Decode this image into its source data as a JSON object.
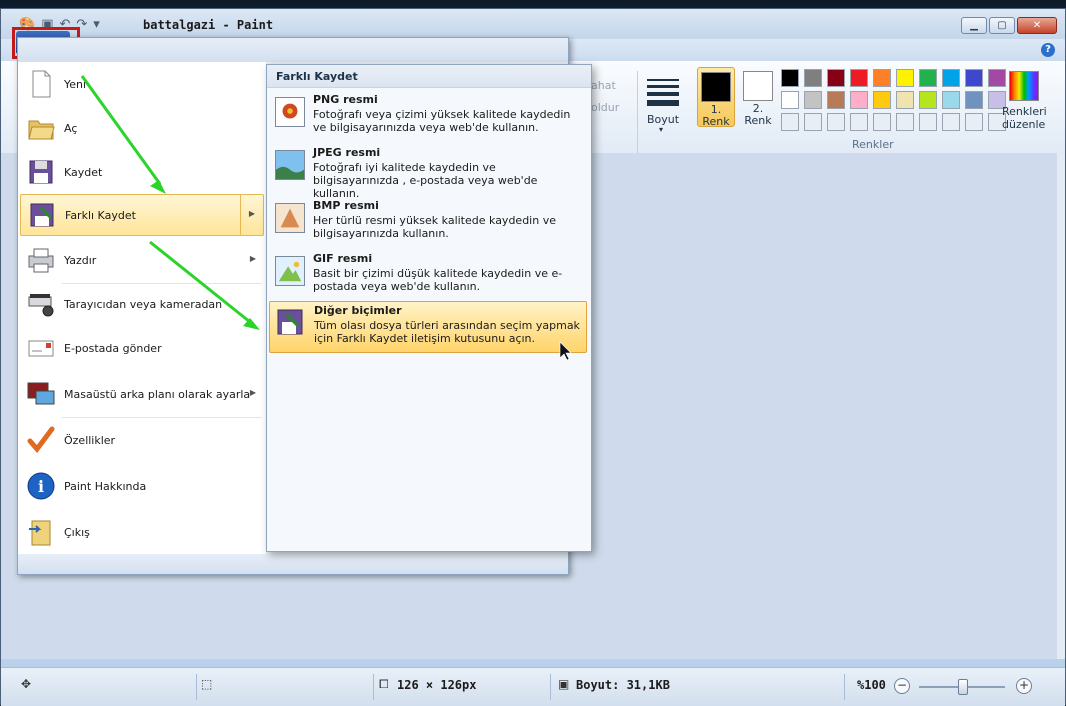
{
  "window": {
    "title": "battalgazi - Paint"
  },
  "ribbon": {
    "partial_labels": [
      "ahat",
      "oldur"
    ],
    "boyut_label": "Boyut",
    "color1_label": "1.\nRenk",
    "color1_line1": "1.",
    "color1_line2": "Renk",
    "color2_line1": "2.",
    "color2_line2": "Renk",
    "edit_colors_line1": "Renkleri",
    "edit_colors_line2": "düzenle",
    "group_label": "Renkler",
    "color1_value": "#000000",
    "color2_value": "#ffffff",
    "palette": [
      "#000000",
      "#7f7f7f",
      "#880015",
      "#ed1c24",
      "#ff7f27",
      "#fff200",
      "#22b14c",
      "#00a2e8",
      "#3f48cc",
      "#a349a4",
      "#ffffff",
      "#c3c3c3",
      "#b97a57",
      "#ffaec9",
      "#ffc90e",
      "#efe4b0",
      "#b5e61d",
      "#99d9ea",
      "#7092be",
      "#c8bfe7",
      "#e8eef6",
      "#e8eef6",
      "#e8eef6",
      "#e8eef6",
      "#e8eef6",
      "#e8eef6",
      "#e8eef6",
      "#e8eef6",
      "#e8eef6",
      "#e8eef6"
    ]
  },
  "app_menu": {
    "items": [
      {
        "label": "Yeni",
        "icon": "new-file-icon"
      },
      {
        "label": "Aç",
        "icon": "open-folder-icon"
      },
      {
        "label": "Kaydet",
        "icon": "save-disk-icon"
      },
      {
        "label": "Farklı Kaydet",
        "icon": "save-as-icon"
      },
      {
        "label": "Yazdır",
        "icon": "printer-icon"
      },
      {
        "label": "Tarayıcıdan veya kameradan",
        "icon": "scanner-icon"
      },
      {
        "label": "E-postada gönder",
        "icon": "email-icon"
      },
      {
        "label": "Masaüstü arka planı olarak ayarla",
        "icon": "desktop-background-icon"
      },
      {
        "label": "Özellikler",
        "icon": "checkmark-icon"
      },
      {
        "label": "Paint Hakkında",
        "icon": "info-icon"
      },
      {
        "label": "Çıkış",
        "icon": "exit-icon"
      }
    ]
  },
  "save_as_menu": {
    "title": "Farklı Kaydet",
    "items": [
      {
        "title": "PNG resmi",
        "desc": "Fotoğrafı veya çizimi yüksek kalitede kaydedin ve bilgisayarınızda veya web'de kullanın."
      },
      {
        "title": "JPEG resmi",
        "desc": "Fotoğrafı iyi kalitede kaydedin ve bilgisayarınızda , e-postada veya web'de kullanın."
      },
      {
        "title": "BMP resmi",
        "desc": "Her türlü resmi yüksek kalitede kaydedin ve bilgisayarınızda kullanın."
      },
      {
        "title": "GIF resmi",
        "desc": "Basit bir çizimi düşük kalitede kaydedin ve e-postada veya web'de kullanın."
      },
      {
        "title": "Diğer biçimler",
        "desc": "Tüm olası dosya türleri arasından seçim yapmak için Farklı Kaydet iletişim kutusunu açın."
      }
    ]
  },
  "status": {
    "dimensions": "126 × 126px",
    "size": "Boyut: 31,1KB",
    "zoom": "%100",
    "zoom_level": 0.5
  }
}
